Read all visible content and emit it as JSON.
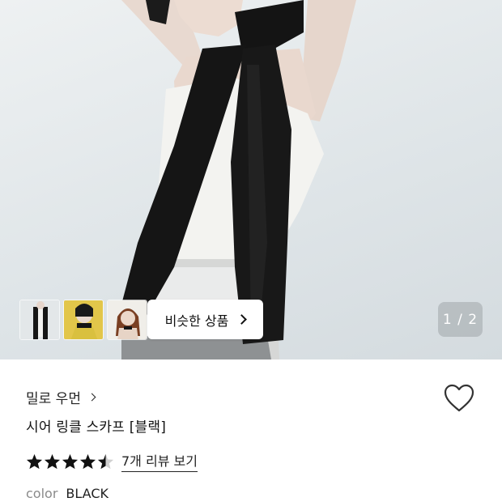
{
  "gallery": {
    "counter": "1 / 2",
    "similar_button_label": "비슷한 상품",
    "thumbnails": [
      "thumbnail-1",
      "thumbnail-2",
      "thumbnail-3"
    ]
  },
  "product": {
    "brand": "밀로 우먼",
    "title": "시어 링클 스카프 [블랙]",
    "rating": 4.5,
    "review_link": "7개 리뷰 보기",
    "color_label": "color",
    "color_value": "BLACK"
  },
  "icons": {
    "wishlist": "heart-icon",
    "brand_arrow": "chevron-right-icon",
    "similar_arrow": "chevron-right-icon",
    "star": "star-icon"
  },
  "colors": {
    "text": "#111111",
    "muted": "#8a8a8a",
    "counter_bg": "#a0a6aa"
  }
}
